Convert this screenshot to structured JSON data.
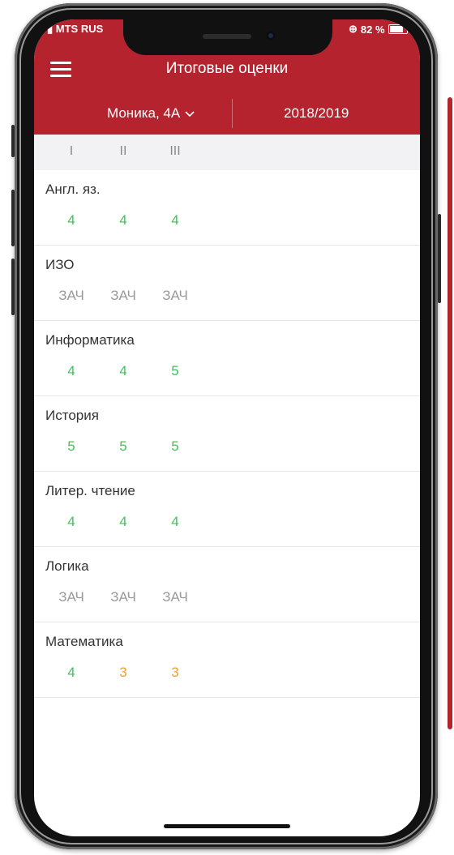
{
  "status_bar": {
    "carrier": "MTS RUS",
    "battery": "82 %"
  },
  "header": {
    "title": "Итоговые оценки",
    "student": "Моника, 4А",
    "year": "2018/2019"
  },
  "terms": [
    "I",
    "II",
    "III"
  ],
  "colors": {
    "brand": "#b5232e",
    "good": "#3cc35a",
    "mid": "#f0a030",
    "pass": "#9a9a9a"
  },
  "subjects": [
    {
      "name": "Англ. яз.",
      "grades": [
        {
          "value": "4",
          "type": "good"
        },
        {
          "value": "4",
          "type": "good"
        },
        {
          "value": "4",
          "type": "good"
        }
      ]
    },
    {
      "name": "ИЗО",
      "grades": [
        {
          "value": "ЗАЧ",
          "type": "pass"
        },
        {
          "value": "ЗАЧ",
          "type": "pass"
        },
        {
          "value": "ЗАЧ",
          "type": "pass"
        }
      ]
    },
    {
      "name": "Информатика",
      "grades": [
        {
          "value": "4",
          "type": "good"
        },
        {
          "value": "4",
          "type": "good"
        },
        {
          "value": "5",
          "type": "good"
        }
      ]
    },
    {
      "name": "История",
      "grades": [
        {
          "value": "5",
          "type": "good"
        },
        {
          "value": "5",
          "type": "good"
        },
        {
          "value": "5",
          "type": "good"
        }
      ]
    },
    {
      "name": "Литер. чтение",
      "grades": [
        {
          "value": "4",
          "type": "good"
        },
        {
          "value": "4",
          "type": "good"
        },
        {
          "value": "4",
          "type": "good"
        }
      ]
    },
    {
      "name": "Логика",
      "grades": [
        {
          "value": "ЗАЧ",
          "type": "pass"
        },
        {
          "value": "ЗАЧ",
          "type": "pass"
        },
        {
          "value": "ЗАЧ",
          "type": "pass"
        }
      ]
    },
    {
      "name": "Математика",
      "grades": [
        {
          "value": "4",
          "type": "good"
        },
        {
          "value": "3",
          "type": "mid"
        },
        {
          "value": "3",
          "type": "mid"
        }
      ]
    }
  ]
}
